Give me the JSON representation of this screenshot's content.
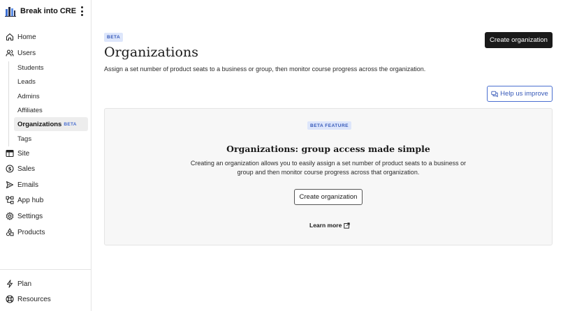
{
  "brand": {
    "name": "Break into CRE",
    "logo_icon": "building-logo-icon",
    "menu_icon": "kebab-menu-icon"
  },
  "sidebar": {
    "items": [
      {
        "label": "Home",
        "icon": "home-icon"
      },
      {
        "label": "Users",
        "icon": "users-icon"
      },
      {
        "label": "Site",
        "icon": "site-icon"
      },
      {
        "label": "Sales",
        "icon": "dollar-icon"
      },
      {
        "label": "Emails",
        "icon": "send-icon"
      },
      {
        "label": "App hub",
        "icon": "app-hub-icon"
      },
      {
        "label": "Settings",
        "icon": "gear-icon"
      },
      {
        "label": "Products",
        "icon": "shapes-icon"
      }
    ],
    "user_subitems": [
      {
        "label": "Students"
      },
      {
        "label": "Leads"
      },
      {
        "label": "Admins"
      },
      {
        "label": "Affiliates"
      },
      {
        "label": "Organizations",
        "badge": "BETA",
        "active": true
      },
      {
        "label": "Tags"
      }
    ],
    "bottom_items": [
      {
        "label": "Plan",
        "icon": "bolt-icon"
      },
      {
        "label": "Resources",
        "icon": "lifebuoy-icon"
      }
    ]
  },
  "header": {
    "badge": "BETA",
    "title": "Organizations",
    "description": "Assign a set number of product seats to a business or group, then monitor course progress across the organization.",
    "create_button": "Create organization",
    "help_button": "Help us improve"
  },
  "empty_state": {
    "badge": "BETA FEATURE",
    "title": "Organizations: group access made simple",
    "description": "Creating an organization allows you to easily assign a set number of product seats to a business or group and then monitor course progress across that organization.",
    "button": "Create organization",
    "learn_more": "Learn more"
  },
  "colors": {
    "accent": "#3558b8",
    "badge_bg": "#dde6fb",
    "primary_button": "#1a1a1a",
    "card_bg": "#f7f7f7"
  }
}
